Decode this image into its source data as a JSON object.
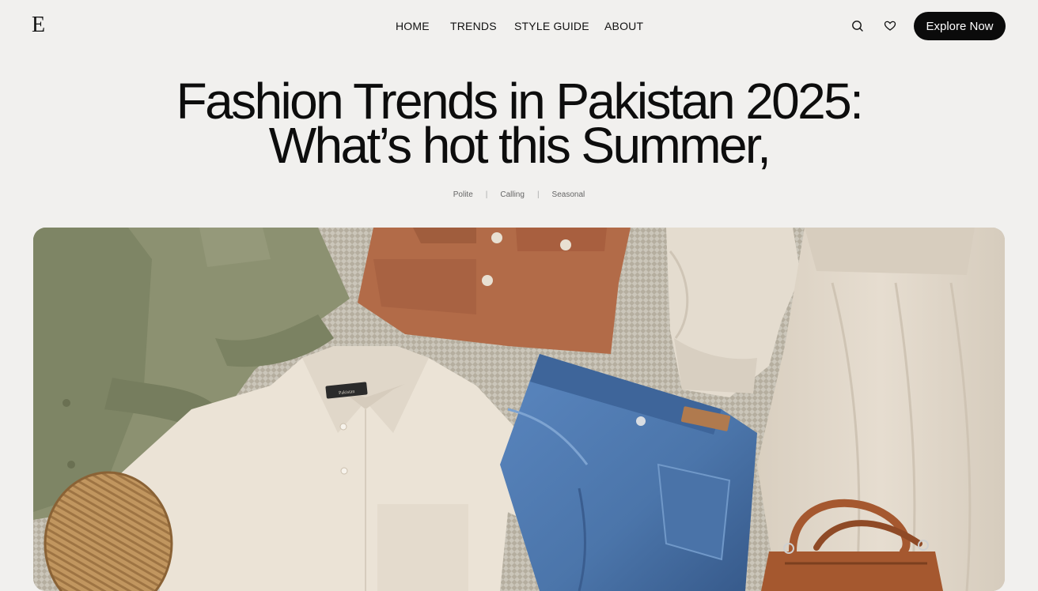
{
  "brand": {
    "logo": "E"
  },
  "nav": {
    "items": [
      {
        "label": "HOME"
      },
      {
        "label": "TRENDS"
      },
      {
        "label": "STYLE GUIDE"
      },
      {
        "label": "ABOUT"
      }
    ]
  },
  "header": {
    "icons": [
      "search-icon",
      "heart-icon"
    ],
    "cta_label": "Explore Now"
  },
  "hero": {
    "title_line1": "Fashion Trends in Pakistan 2025:",
    "title_line2": "What’s hot this Summer,",
    "meta": [
      "Polite",
      "Calling",
      "Seasonal"
    ],
    "meta_separator": "|",
    "garment_label": "Pakistan",
    "image_subject": "flat-lay-summer-clothing"
  },
  "colors": {
    "background": "#f1f0ee",
    "text": "#111111",
    "cta_bg": "#0b0b0b",
    "cta_text": "#ffffff",
    "olive": "#8b9070",
    "rust": "#b06a47",
    "denim": "#4f78ad",
    "linen": "#e9e2d6",
    "wicker": "#b78a55",
    "leather": "#a0562f"
  }
}
